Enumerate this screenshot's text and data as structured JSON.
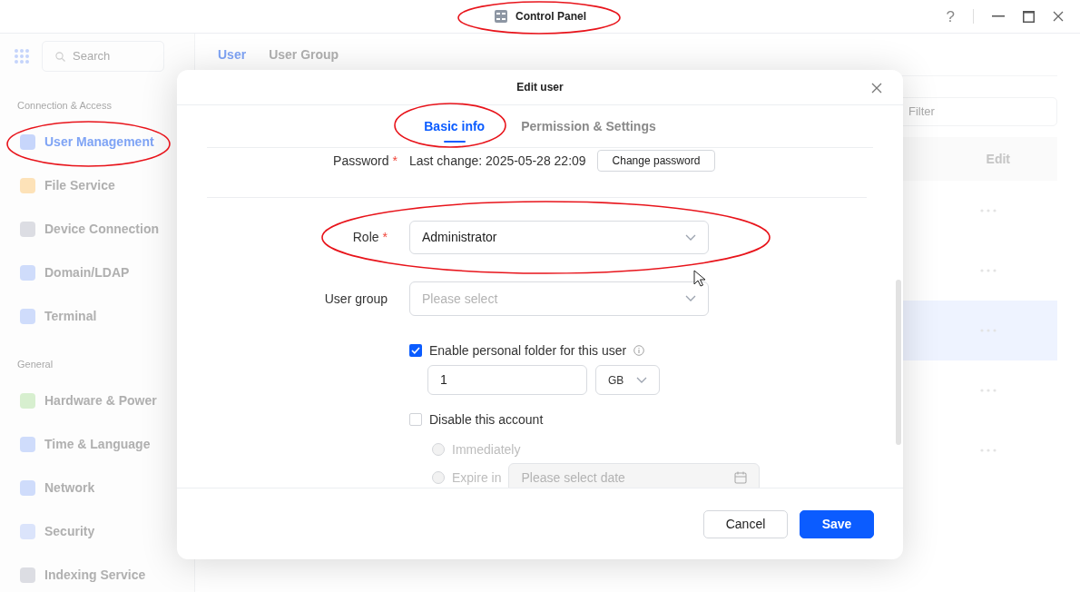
{
  "title_bar": {
    "title": "Control Panel",
    "help": "?"
  },
  "sidebar": {
    "search": {
      "placeholder": "Search"
    },
    "sections": [
      {
        "heading": "Connection & Access",
        "items": [
          {
            "label": "User Management",
            "selected": true
          },
          {
            "label": "File Service",
            "selected": false
          },
          {
            "label": "Device Connection",
            "selected": false
          },
          {
            "label": "Domain/LDAP",
            "selected": false
          },
          {
            "label": "Terminal",
            "selected": false
          }
        ]
      },
      {
        "heading": "General",
        "items": [
          {
            "label": "Hardware & Power",
            "selected": false
          },
          {
            "label": "Time & Language",
            "selected": false
          },
          {
            "label": "Network",
            "selected": false
          },
          {
            "label": "Security",
            "selected": false
          },
          {
            "label": "Indexing Service",
            "selected": false
          }
        ]
      }
    ]
  },
  "main": {
    "tabs": [
      {
        "label": "User",
        "selected": true
      },
      {
        "label": "User Group",
        "selected": false
      }
    ],
    "filter": {
      "placeholder": "Filter"
    },
    "table": {
      "columns": [
        "Edit"
      ],
      "rows": [
        {
          "highlighted": false
        },
        {
          "highlighted": false
        },
        {
          "highlighted": true
        },
        {
          "highlighted": false
        },
        {
          "highlighted": false
        }
      ]
    }
  },
  "dialog": {
    "title": "Edit user",
    "tabs": [
      {
        "label": "Basic info",
        "selected": true
      },
      {
        "label": "Permission & Settings",
        "selected": false
      }
    ],
    "password": {
      "label": "Password",
      "required_mark": "*",
      "last_change": "Last change: 2025-05-28 22:09",
      "button": "Change password"
    },
    "role": {
      "label": "Role",
      "required_mark": "*",
      "value": "Administrator"
    },
    "user_group": {
      "label": "User group",
      "placeholder": "Please select"
    },
    "personal_folder": {
      "label": "Enable personal folder for this user",
      "checked": true,
      "size": "1",
      "unit": "GB"
    },
    "disable_account": {
      "label": "Disable this account",
      "checked": false,
      "options": [
        {
          "label": "Immediately",
          "selected": false,
          "disabled": true
        },
        {
          "label": "Expire in",
          "selected": false,
          "disabled": true
        }
      ],
      "date_placeholder": "Please select date"
    },
    "buttons": [
      {
        "label": "Cancel",
        "kind": "secondary"
      },
      {
        "label": "Save",
        "kind": "primary"
      }
    ]
  }
}
